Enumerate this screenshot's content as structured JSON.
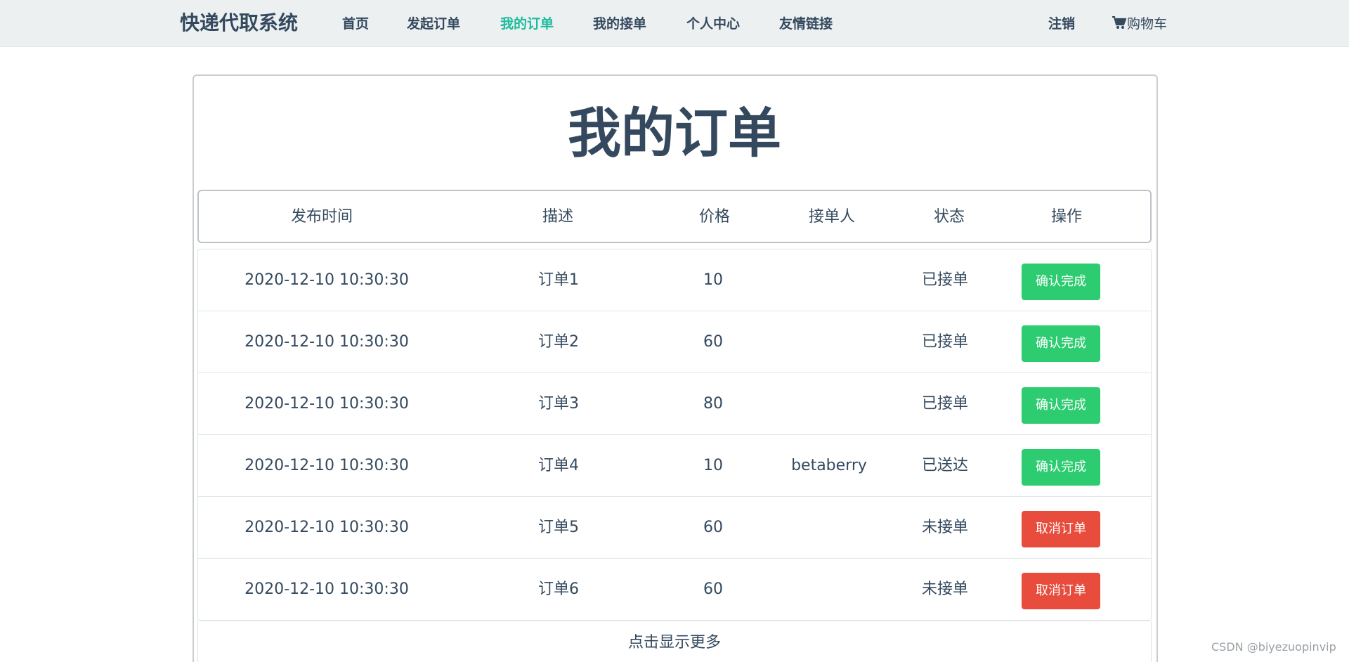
{
  "nav": {
    "brand": "快递代取系统",
    "links": [
      "首页",
      "发起订单",
      "我的订单",
      "我的接单",
      "个人中心",
      "友情链接"
    ],
    "active_index": 2,
    "logout": "注销",
    "cart": "购物车",
    "colors": {
      "bar": "#ecf0f1",
      "text": "#34495e",
      "active": "#1abc9c"
    }
  },
  "page": {
    "title": "我的订单"
  },
  "table": {
    "headers": [
      "发布时间",
      "描述",
      "价格",
      "接单人",
      "状态",
      "操作"
    ],
    "rows": [
      {
        "time": "2020-12-10 10:30:30",
        "desc": "订单1",
        "price": "10",
        "taker": "",
        "status": "已接单",
        "action": "确认完成",
        "action_color": "#2ecc71"
      },
      {
        "time": "2020-12-10 10:30:30",
        "desc": "订单2",
        "price": "60",
        "taker": "",
        "status": "已接单",
        "action": "确认完成",
        "action_color": "#2ecc71"
      },
      {
        "time": "2020-12-10 10:30:30",
        "desc": "订单3",
        "price": "80",
        "taker": "",
        "status": "已接单",
        "action": "确认完成",
        "action_color": "#2ecc71"
      },
      {
        "time": "2020-12-10 10:30:30",
        "desc": "订单4",
        "price": "10",
        "taker": "betaberry",
        "status": "已送达",
        "action": "确认完成",
        "action_color": "#2ecc71"
      },
      {
        "time": "2020-12-10 10:30:30",
        "desc": "订单5",
        "price": "60",
        "taker": "",
        "status": "未接单",
        "action": "取消订单",
        "action_color": "#e74c3c"
      },
      {
        "time": "2020-12-10 10:30:30",
        "desc": "订单6",
        "price": "60",
        "taker": "",
        "status": "未接单",
        "action": "取消订单",
        "action_color": "#e74c3c"
      }
    ],
    "load_more": "点击显示更多"
  },
  "watermark": "CSDN @biyezuopinvip"
}
